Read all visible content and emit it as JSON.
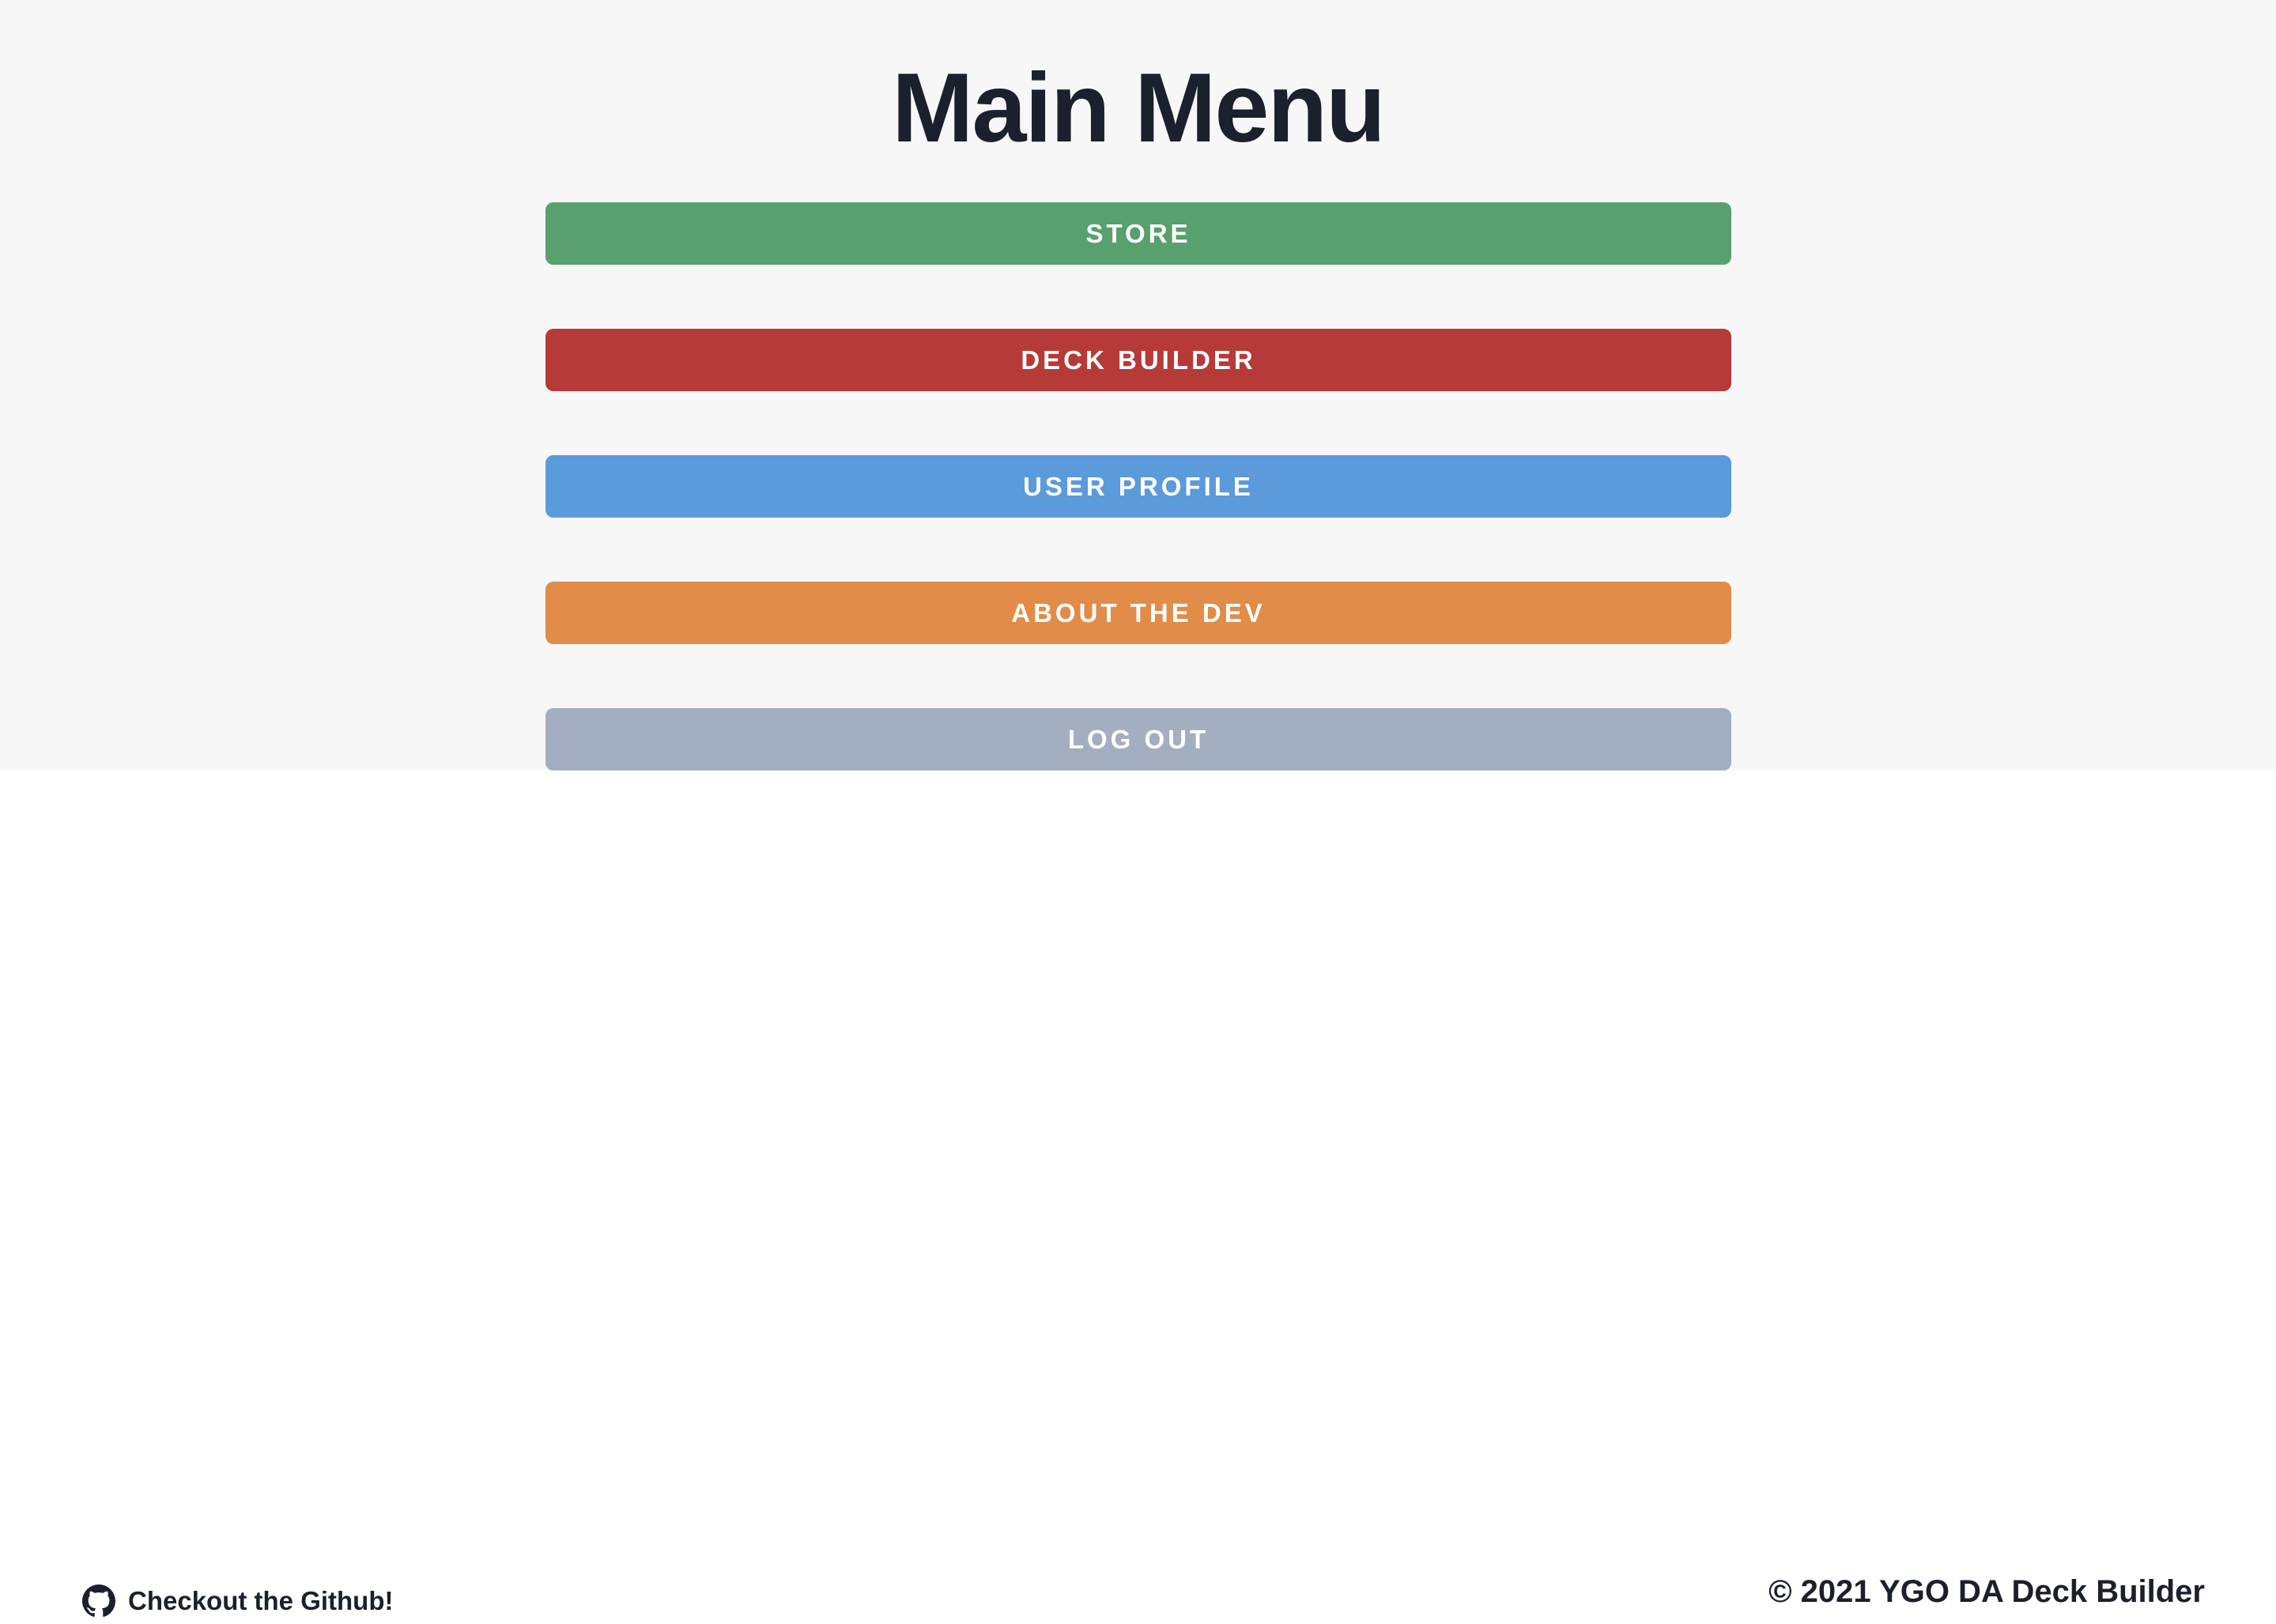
{
  "page": {
    "title": "Main Menu"
  },
  "menu": {
    "buttons": [
      {
        "label": "STORE",
        "color": "#58a06e"
      },
      {
        "label": "DECK BUILDER",
        "color": "#b53a38"
      },
      {
        "label": "USER PROFILE",
        "color": "#5b9adb"
      },
      {
        "label": "ABOUT THE DEV",
        "color": "#e18c48"
      },
      {
        "label": "LOG OUT",
        "color": "#a3afc0"
      }
    ]
  },
  "footer": {
    "github_label": "Checkout the Github!",
    "github_icon": "github-icon",
    "copyright": "© 2021 YGO DA Deck Builder"
  },
  "colors": {
    "text_dark": "#1a202c",
    "main_background": "#f7f7f7",
    "footer_background": "#ffffff"
  }
}
